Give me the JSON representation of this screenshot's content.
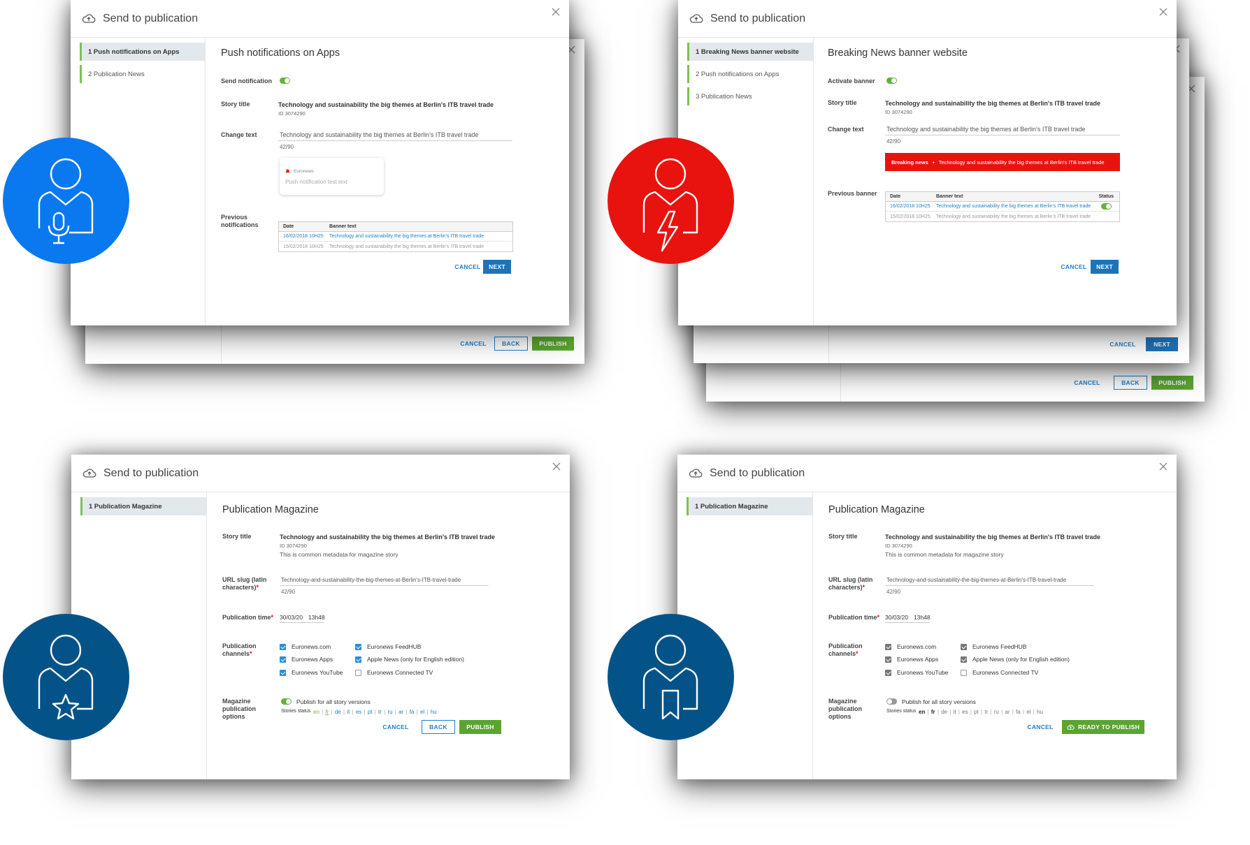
{
  "dialog_title": "Send to publication",
  "common": {
    "story_title_label": "Story title",
    "story_title": "Technology and sustainability the big themes at Berlin's ITB travel trade",
    "story_id": "ID 3074290",
    "change_text_label": "Change text",
    "counter": "42/90",
    "cancel": "CANCEL",
    "next": "NEXT",
    "back": "BACK",
    "publish": "PUBLISH"
  },
  "push": {
    "steps": [
      "1  Push notifications on Apps",
      "2  Publication News"
    ],
    "heading": "Push notifications on Apps",
    "send_label": "Send notification",
    "preview_app": "Euronews",
    "preview_text": "Push notification test text",
    "prev_label": "Previous notifications",
    "table": {
      "headers": [
        "Date",
        "Banner text"
      ],
      "rows": [
        [
          "16/02/2018 10H25",
          "Technology and sustainability the big themes at Berlin's ITB travel trade"
        ],
        [
          "15/02/2018 10H25",
          "Technology and sustainability the big themes at Berlin's ITB travel trade"
        ]
      ]
    }
  },
  "breaking": {
    "steps": [
      "1  Breaking News banner website",
      "2  Push notifications on Apps",
      "3  Publication News"
    ],
    "heading": "Breaking News banner website",
    "activate_label": "Activate banner",
    "banner_tag": "Breaking news",
    "banner_sep": "•",
    "prev_label": "Previous banner",
    "table": {
      "headers": [
        "Date",
        "Banner text",
        "Status"
      ],
      "rows": [
        [
          "16/02/2018 10H25",
          "Technology and sustainability the big themes at Berlin's ITB travel trade"
        ],
        [
          "15/02/2018 10H25",
          "Technology and sustainability the big themes at Berlin's ITB travel trade"
        ]
      ]
    }
  },
  "magazine": {
    "step": "1  Publication Magazine",
    "heading": "Publication Magazine",
    "common_meta": "This is common metadata for magazine story",
    "slug_label": "URL slug (latin characters)",
    "req": "*",
    "slug": "Technology-and-sustainability-the-big-themes-at-Berlin's-ITB-travel-trade",
    "time_label": "Publication time",
    "date": "30/03/20",
    "time": "13h48",
    "channels_label": "Publication channels",
    "channels": [
      "Euronews.com",
      "Euronews Apps",
      "Euronews YouTube",
      "Euronews FeedHUB",
      "Apple News (only for English edition)",
      "Euronews Connected TV"
    ],
    "options_label": "Magazine publication options",
    "all_versions": "Publish for all story versions",
    "status_label": "Stories status",
    "langs": [
      "en",
      "fr",
      "de",
      "it",
      "es",
      "pt",
      "tr",
      "ru",
      "ar",
      "fa",
      "el",
      "hu"
    ],
    "sep": "|",
    "ready": "READY TO PUBLISH"
  },
  "colors": {
    "blue_icon": "#0a79f0",
    "red_icon": "#e8130f",
    "navy_icon": "#045388",
    "banner_red": "#e8130f",
    "primary": "#1e73b8",
    "green": "#5aa531"
  },
  "icons": [
    "cloud-upload-icon",
    "close-icon",
    "user-microphone-icon",
    "user-lightning-icon",
    "user-star-icon",
    "user-bookmark-icon",
    "bell-icon"
  ]
}
